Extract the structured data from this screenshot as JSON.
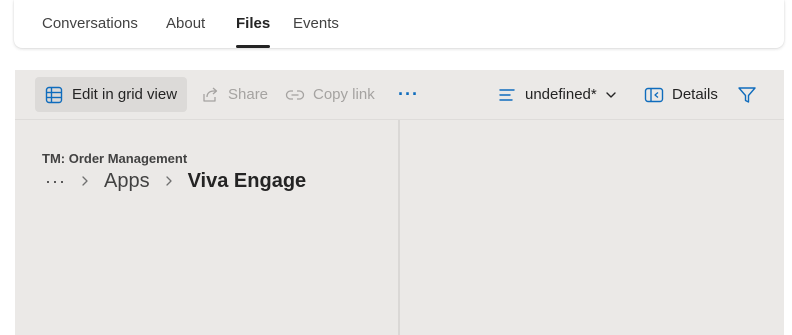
{
  "tabs": [
    {
      "label": "Conversations",
      "active": false
    },
    {
      "label": "About",
      "active": false
    },
    {
      "label": "Files",
      "active": true
    },
    {
      "label": "Events",
      "active": false
    }
  ],
  "toolbar": {
    "edit_grid_label": "Edit in grid view",
    "share_label": "Share",
    "copy_link_label": "Copy link",
    "more_label": "···",
    "view_label": "undefined*",
    "details_label": "Details"
  },
  "breadcrumb": {
    "site": "TM: Order Management",
    "more": "···",
    "items": [
      "Apps"
    ],
    "current": "Viva Engage"
  },
  "colors": {
    "accent": "#0f6cbd",
    "panel_bg": "#ebe9e7",
    "disabled": "#a5a3a1"
  }
}
